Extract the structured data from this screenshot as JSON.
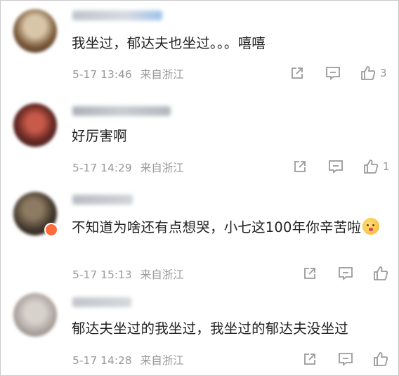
{
  "comments": [
    {
      "text": "我坐过，郁达夫也坐过。。。嘻嘻",
      "date": "5-17 13:46",
      "location": "来自浙江",
      "likes": "3"
    },
    {
      "text": "好厉害啊",
      "date": "5-17 14:29",
      "location": "来自浙江",
      "likes": "1"
    },
    {
      "text": "不知道为啥还有点想哭，小七这100年你辛苦啦",
      "date": "5-17 15:13",
      "location": "来自浙江",
      "likes": ""
    },
    {
      "text": "郁达夫坐过的我坐过，我坐过的郁达夫没坐过",
      "date": "5-17 14:28",
      "location": "来自浙江",
      "likes": ""
    }
  ],
  "icons": {
    "share": "share-icon",
    "reply": "comment-icon",
    "like": "thumbs-up-icon"
  },
  "colors": {
    "text": "#222222",
    "meta": "#999999",
    "icon": "#9a9a9a"
  }
}
